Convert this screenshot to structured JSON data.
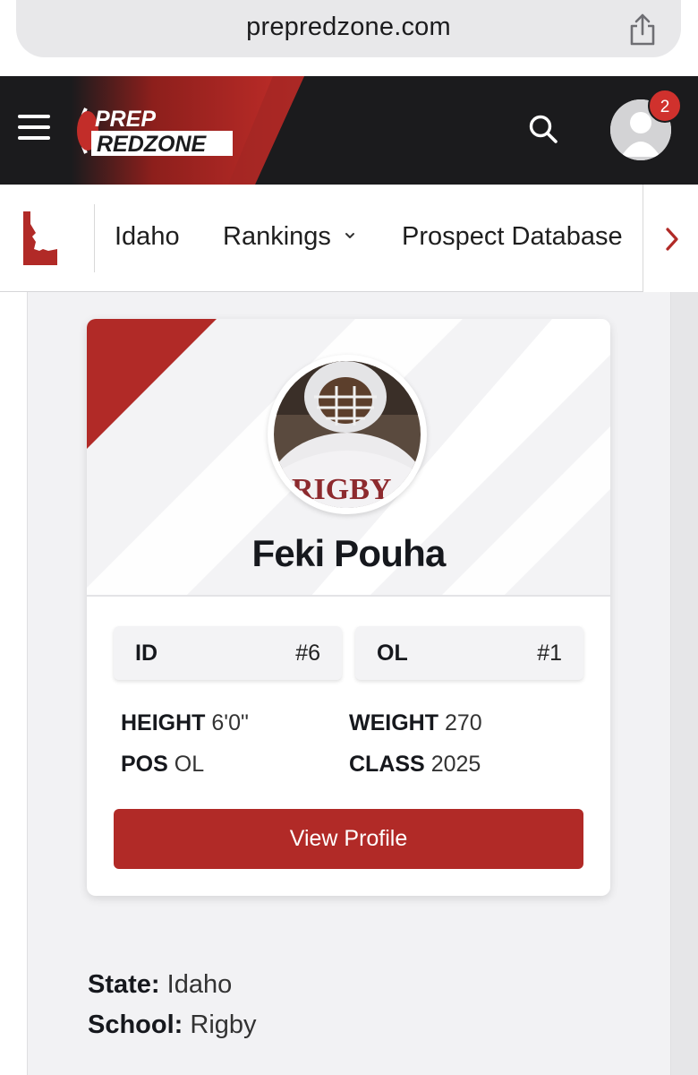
{
  "browser": {
    "url": "prepredzone.com"
  },
  "header": {
    "logo_line1": "PREP",
    "logo_line2": "REDZONE",
    "notification_count": "2",
    "colors": {
      "background": "#1b1b1d",
      "accent": "#d0312d"
    }
  },
  "subnav": {
    "items": [
      {
        "label": "Idaho"
      },
      {
        "label": "Rankings"
      },
      {
        "label": "Prospect Database"
      }
    ]
  },
  "player": {
    "name": "Feki Pouha",
    "jersey_text": "RIGBY",
    "state_rank_label": "ID",
    "state_rank_value": "#6",
    "position_rank_label": "OL",
    "position_rank_value": "#1",
    "height_label": "HEIGHT",
    "height_value": "6'0\"",
    "weight_label": "WEIGHT",
    "weight_value": "270",
    "pos_label": "POS",
    "pos_value": "OL",
    "class_label": "CLASS",
    "class_value": "2025",
    "button_label": "View Profile"
  },
  "details": {
    "state_label": "State:",
    "state_value": "Idaho",
    "school_label": "School:",
    "school_value": "Rigby"
  }
}
